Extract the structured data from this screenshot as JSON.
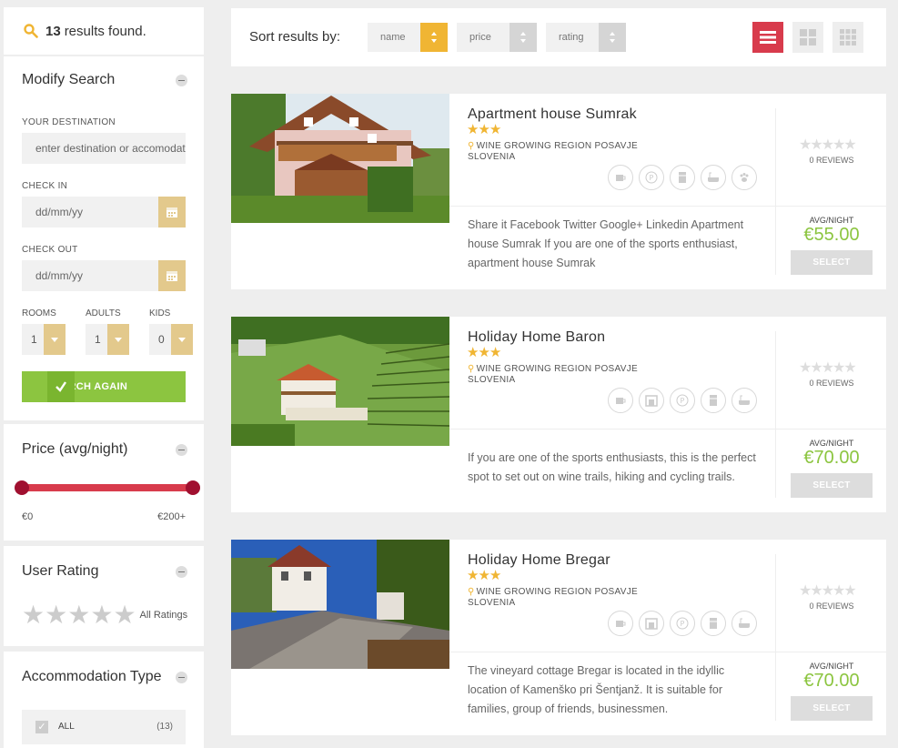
{
  "results": {
    "count": "13",
    "text": "results found."
  },
  "modify": {
    "title": "Modify Search",
    "destination_label": "YOUR DESTINATION",
    "destination_placeholder": "enter destination or accomodation",
    "checkin_label": "CHECK IN",
    "checkin_placeholder": "dd/mm/yy",
    "checkout_label": "CHECK OUT",
    "checkout_placeholder": "dd/mm/yy",
    "rooms_label": "ROOMS",
    "rooms_value": "1",
    "adults_label": "ADULTS",
    "adults_value": "1",
    "kids_label": "KIDS",
    "kids_value": "0",
    "search_button": "SEARCH AGAIN"
  },
  "price_filter": {
    "title": "Price (avg/night)",
    "min_label": "€0",
    "max_label": "€200+",
    "range_min_fraction": 0,
    "range_max_fraction": 1
  },
  "rating_filter": {
    "title": "User Rating",
    "all_label": "All Ratings"
  },
  "accommodation_filter": {
    "title": "Accommodation Type",
    "items": [
      {
        "label": "ALL",
        "count": "(13)"
      }
    ]
  },
  "sort": {
    "label": "Sort results by:",
    "options": [
      {
        "label": "name",
        "active": true
      },
      {
        "label": "price",
        "active": false
      },
      {
        "label": "rating",
        "active": false
      }
    ]
  },
  "listings": [
    {
      "title": "Apartment house Sumrak",
      "stars": "★★★",
      "region": "WINE GROWING REGION POSAVJE",
      "country": "SLOVENIA",
      "amenities": [
        "coffee-icon",
        "parking-icon",
        "fridge-icon",
        "bathtub-icon",
        "pet-icon"
      ],
      "description": "Share it Facebook Twitter Google+ Linkedin Apartment house Sumrak If you are one of the sports enthusiast, apartment house Sumrak",
      "review_stars": "★★★★★",
      "reviews": "0 REVIEWS",
      "avg_label": "AVG/NIGHT",
      "price": "€55.00",
      "select": "SELECT"
    },
    {
      "title": "Holiday Home Baron",
      "stars": "★★★",
      "region": "WINE GROWING REGION POSAVJE",
      "country": "SLOVENIA",
      "amenities": [
        "coffee-icon",
        "fireplace-icon",
        "parking-icon",
        "fridge-icon",
        "bathtub-icon"
      ],
      "description": "If you are one of the sports enthusiasts, this is the perfect spot to set out on wine trails, hiking and cycling trails.",
      "review_stars": "★★★★★",
      "reviews": "0 REVIEWS",
      "avg_label": "AVG/NIGHT",
      "price": "€70.00",
      "select": "SELECT"
    },
    {
      "title": "Holiday Home Bregar",
      "stars": "★★★",
      "region": "WINE GROWING REGION POSAVJE",
      "country": "SLOVENIA",
      "amenities": [
        "coffee-icon",
        "fireplace-icon",
        "parking-icon",
        "fridge-icon",
        "bathtub-icon"
      ],
      "description": "The vineyard cottage Bregar is located in the idyllic location of Kamenško pri Šentjanž. It is suitable for families, group of friends, businessmen.",
      "review_stars": "★★★★★",
      "reviews": "0 REVIEWS",
      "avg_label": "AVG/NIGHT",
      "price": "€70.00",
      "select": "SELECT"
    }
  ],
  "colors": {
    "accent_gold": "#e3c98c",
    "sort_active": "#f0b533",
    "green": "#8cc540",
    "red": "#d83b4c"
  }
}
